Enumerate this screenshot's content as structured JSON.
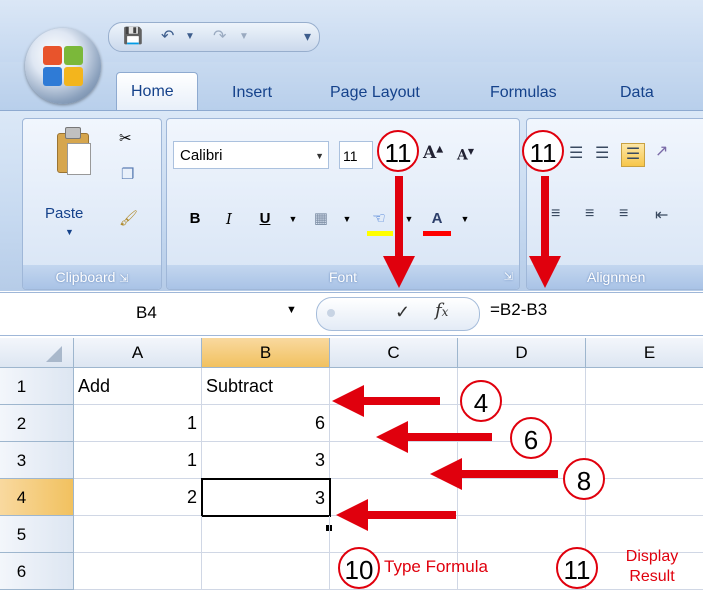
{
  "quick_access": {
    "save_icon": "save-icon",
    "undo_icon": "undo-icon",
    "redo_icon": "redo-icon",
    "customize_icon": "customize-qat-icon"
  },
  "tabs": {
    "home": "Home",
    "insert": "Insert",
    "page_layout": "Page Layout",
    "formulas": "Formulas",
    "data": "Data"
  },
  "ribbon": {
    "clipboard": {
      "paste_label": "Paste",
      "group_label": "Clipboard",
      "cut_icon": "scissors-icon",
      "copy_icon": "copy-icon",
      "format_painter_icon": "paintbrush-icon"
    },
    "font": {
      "font_name": "Calibri",
      "font_size": "11",
      "group_label": "Font",
      "grow_label": "A",
      "shrink_label": "A",
      "bold": "B",
      "italic": "I",
      "underline": "U",
      "fill_color": "#ffff00",
      "font_color": "#ff0000"
    },
    "alignment": {
      "group_label": "Alignmen"
    }
  },
  "formula_bar": {
    "name_box": "B4",
    "formula": "=B2-B3"
  },
  "columns": [
    "A",
    "B",
    "C",
    "D",
    "E"
  ],
  "selected_column": "B",
  "rows": [
    {
      "num": "1",
      "a": "Add",
      "b": "Subtract"
    },
    {
      "num": "2",
      "a": "1",
      "b": "6"
    },
    {
      "num": "3",
      "a": "1",
      "b": "3"
    },
    {
      "num": "4",
      "a": "2",
      "b": "3"
    },
    {
      "num": "5",
      "a": "",
      "b": ""
    },
    {
      "num": "6",
      "a": "",
      "b": ""
    }
  ],
  "selected_row": "4",
  "annotations": {
    "step_11_font": "11",
    "step_11_align": "11",
    "step_4": "4",
    "step_6": "6",
    "step_8": "8",
    "step_10": "10",
    "step_10_text": "Type Formula",
    "step_11_bottom": "11",
    "step_11_text_1": "Display",
    "step_11_text_2": "Result",
    "color": "#e0000d"
  }
}
